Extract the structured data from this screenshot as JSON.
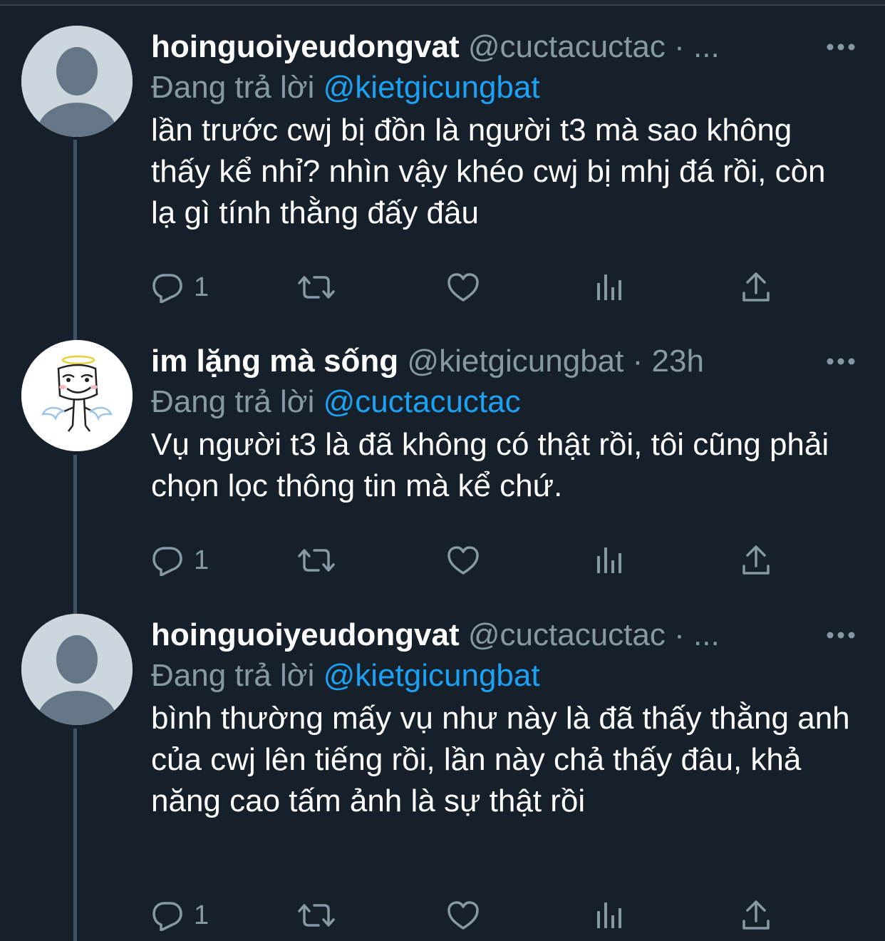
{
  "colors": {
    "background": "#15202b",
    "text": "#ffffff",
    "secondary": "#8899a6",
    "link": "#1da1f2",
    "thread_line": "#3d5466",
    "avatar_default_bg": "#ccd6dd",
    "avatar_default_fg": "#657786"
  },
  "tweets": [
    {
      "display_name": "hoinguoiyeudongvat",
      "handle": "@cuctacuctac",
      "dot": "·",
      "time": "...",
      "reply_prefix": "Đang trả lời",
      "reply_target": "@kietgicungbat",
      "text": "lần trước cwj bị đồn là người t3 mà sao không thấy kể nhỉ? nhìn vậy khéo cwj bị mhj đá rồi, còn lạ gì tính thằng đấy đâu",
      "avatar": "default-avatar",
      "reply_count": "1",
      "icons": [
        "reply-icon",
        "retweet-icon",
        "like-icon",
        "analytics-icon",
        "share-icon"
      ]
    },
    {
      "display_name": "im lặng mà sống",
      "handle": "@kietgicungbat",
      "dot": "·",
      "time": "23h",
      "reply_prefix": "Đang trả lời",
      "reply_target": "@cuctacuctac",
      "text": "Vụ người t3 là đã không có thật rồi, tôi cũng phải chọn lọc thông tin mà kể chứ.",
      "avatar": "angel-meme-avatar",
      "reply_count": "1",
      "icons": [
        "reply-icon",
        "retweet-icon",
        "like-icon",
        "analytics-icon",
        "share-icon"
      ]
    },
    {
      "display_name": "hoinguoiyeudongvat",
      "handle": "@cuctacuctac",
      "dot": "·",
      "time": "...",
      "reply_prefix": "Đang trả lời",
      "reply_target": "@kietgicungbat",
      "text": "bình thường mấy vụ như này là đã thấy thằng anh của cwj lên tiếng rồi, lần này chả thấy đâu, khả năng cao tấm ảnh là sự thật rồi",
      "avatar": "default-avatar",
      "reply_count": "1",
      "icons": [
        "reply-icon",
        "retweet-icon",
        "like-icon",
        "analytics-icon",
        "share-icon"
      ]
    }
  ]
}
